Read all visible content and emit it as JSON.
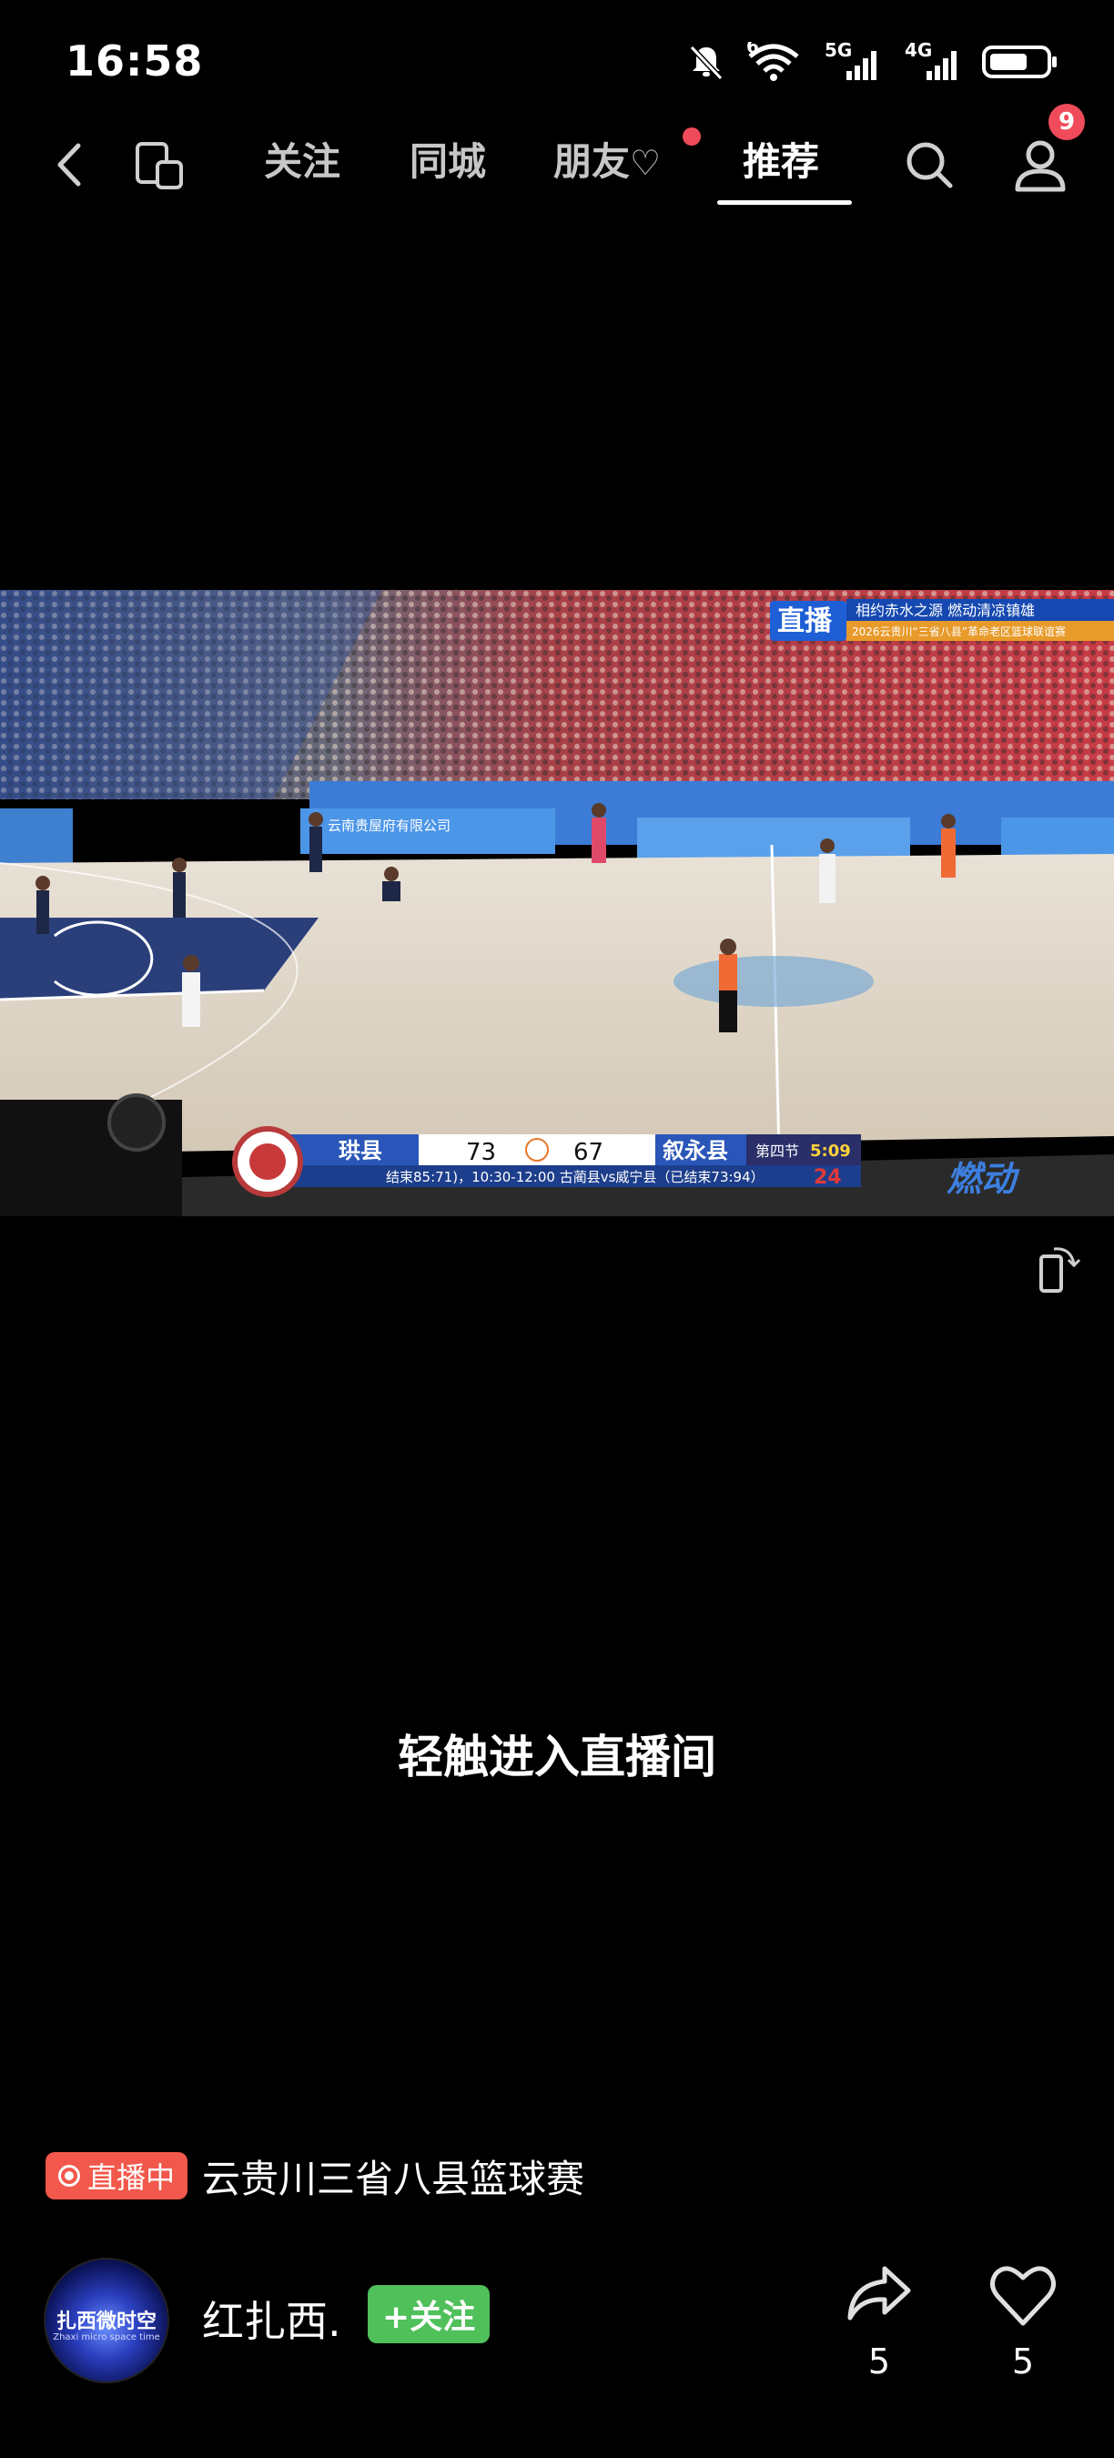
{
  "status_bar": {
    "time": "16:58",
    "signal_1": "5G",
    "signal_2": "4G",
    "wifi_index": "6"
  },
  "nav": {
    "tabs": [
      {
        "label": "关注"
      },
      {
        "label": "同城"
      },
      {
        "label": "朋友"
      },
      {
        "label": "推荐"
      }
    ],
    "active_tab": "推荐",
    "profile_badge": "9"
  },
  "video": {
    "live_logo": "直播",
    "banner_line1": "相约赤水之源 燃动清凉镇雄",
    "banner_line2": "2026云贵川“三省八县”革命老区篮球联谊赛",
    "court_board_text": "云南贵屋府有限公司",
    "scoreboard": {
      "home_team": "珙县",
      "home_score": "73",
      "away_score": "67",
      "away_team": "叙永县",
      "period": "第四节",
      "clock": "5:09",
      "shot_clock": "24",
      "ticker": "结束85:71)，10:30-12:00 古蔺县vs威宁县（已结束73:94）"
    },
    "corner_text": "燃动"
  },
  "overlay": {
    "enter_live": "轻触进入直播间"
  },
  "live": {
    "badge": "直播中",
    "title": "云贵川三省八县篮球赛"
  },
  "author": {
    "avatar_text": "扎西微时空",
    "avatar_sub": "Zhaxi micro space time",
    "name": "红扎西.",
    "follow_label": "+关注"
  },
  "actions": {
    "share_count": "5",
    "like_count": "5"
  },
  "colors": {
    "accent_red": "#f2584b",
    "follow_green": "#4fc05a",
    "badge_red": "#f04b5a"
  }
}
